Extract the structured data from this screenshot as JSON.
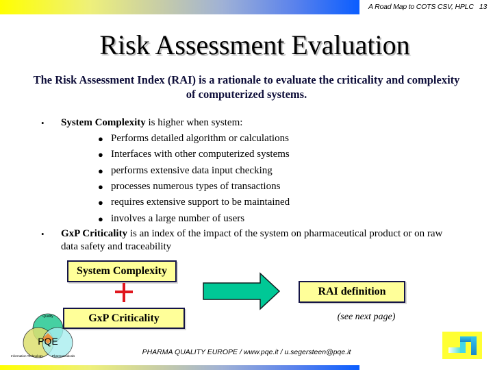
{
  "header": {
    "running_title": "A Road Map to COTS CSV, HPLC",
    "page_number": "13"
  },
  "slide": {
    "title": "Risk Assessment Evaluation",
    "intro": "The Risk Assessment Index (RAI) is a rationale to evaluate the criticality and complexity of computerized systems.",
    "bullets": [
      {
        "marker": "•",
        "term": "System Complexity",
        "text": " is higher when system:",
        "sub_items": [
          "Performs detailed algorithm or calculations",
          "Interfaces with other computerized systems",
          "performs extensive data input checking",
          "processes numerous types of transactions",
          "requires extensive support to be maintained",
          "involves a large number of users"
        ]
      },
      {
        "marker": "•",
        "term": "GxP Criticality",
        "text": " is an index of the impact of the system on pharmaceutical product or on raw data safety and traceability"
      }
    ],
    "sub_marker": "●"
  },
  "diagram": {
    "box_system_complexity": "System Complexity",
    "plus_symbol": "+",
    "box_gxp_criticality": "GxP Criticality",
    "box_rai_definition": "RAI definition",
    "see_next_page": "(see next page)",
    "colors": {
      "box_fill": "#ffff99",
      "box_border": "#141446",
      "plus": "#e0161d",
      "arrow_fill": "#00c896",
      "arrow_stroke": "#102020"
    }
  },
  "footer": {
    "text": "PHARMA QUALITY EUROPE / www.pqe.it / u.segersteen@pqe.it",
    "logo": {
      "brand": "PQE",
      "circles": [
        "Quality",
        "Information Technology",
        "Pharmaceuticals"
      ]
    }
  }
}
